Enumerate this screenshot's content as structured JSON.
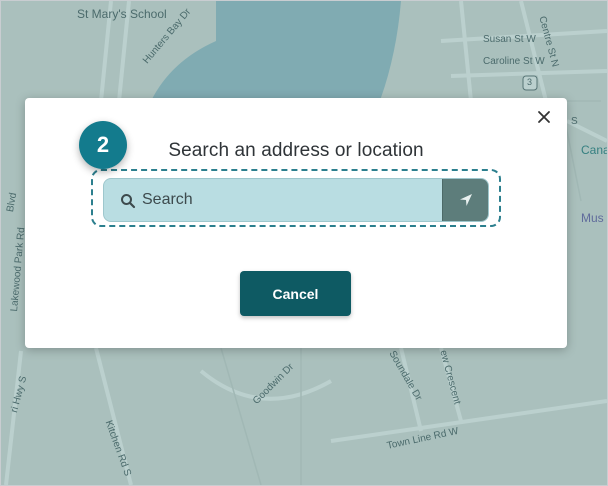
{
  "map": {
    "labels": {
      "school": "St Mary's School",
      "hunters_bay": "Hunters Bay Dr",
      "susan": "Susan St W",
      "caroline": "Caroline St W",
      "centre": "Centre St N",
      "route_badge": "3",
      "blvd": "Blvd",
      "lakewood": "Lakewood Park Rd",
      "hwy": "ri Hwy S",
      "cana": "Cana",
      "mus": "Mus",
      "s_edge": "S",
      "goodwin": "Goodwin Dr",
      "soundale": "Soundale Dr",
      "crescent": "ew Crescent",
      "kitchen": "Kitchen Rd S",
      "townline": "Town Line Rd W"
    }
  },
  "dialog": {
    "title": "Search an address or location",
    "close_icon": "close-icon",
    "search": {
      "placeholder": "Search",
      "icon": "search-icon",
      "locate_icon": "navigation-arrow-icon"
    },
    "cancel_label": "Cancel"
  },
  "badge": {
    "step": "2"
  },
  "colors": {
    "overlay": "#2c6e66",
    "badge": "#137b8d",
    "cancel": "#0e5a63",
    "search_bg": "#b9dde2",
    "locate_bg": "#5d7d7b",
    "outline": "#2c7f8e"
  }
}
